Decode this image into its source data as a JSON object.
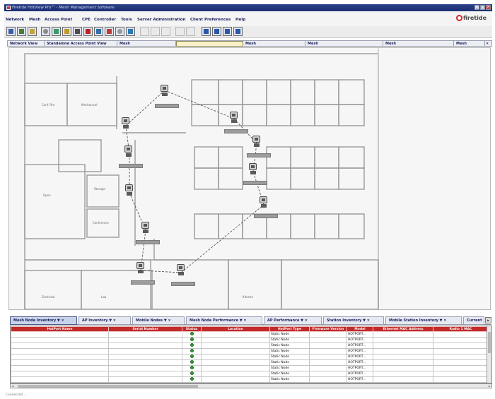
{
  "window": {
    "title": "Firetide HotView Pro™ - Mesh Management Software"
  },
  "menu": [
    {
      "label": "Network"
    },
    {
      "label": "Mesh"
    },
    {
      "label": "Access Point"
    },
    {
      "label": "CPE"
    },
    {
      "label": "Controller"
    },
    {
      "label": "Tools"
    },
    {
      "label": "Server Administration"
    },
    {
      "label": "Client Preferences"
    },
    {
      "label": "Help"
    }
  ],
  "brand": {
    "logo_text": "firetide"
  },
  "toolbar": {
    "icons": [
      "grid-icon",
      "tree-icon",
      "layout-icon",
      "wrench-icon",
      "map-icon",
      "node-icon",
      "ap-icon",
      "alarm-icon",
      "report-icon",
      "stop-icon",
      "gear-icon",
      "save-icon",
      "table-icon",
      "table-icon",
      "table-icon",
      "list-icon",
      "list-icon",
      "zoom-in-icon",
      "zoom-out-icon",
      "zoom-fit-icon",
      "zoom-actual-icon"
    ]
  },
  "view_tabs": [
    {
      "label": "Network View"
    },
    {
      "label": "Standalone Access Point View"
    },
    {
      "label": "Mesh"
    },
    {
      "label": ""
    },
    {
      "label": "Mesh"
    },
    {
      "label": "Mesh"
    },
    {
      "label": "Mesh"
    },
    {
      "label": "Mesh"
    }
  ],
  "map": {
    "rooms": [
      "Conf. Rm",
      "Mechanical",
      "Storage",
      "Conference",
      "Open",
      "Electrical",
      "Lab",
      "Kitchen"
    ],
    "ap_count": 12
  },
  "bottom_tabs": [
    {
      "label": "Mesh Node Inventory"
    },
    {
      "label": "AP Inventory"
    },
    {
      "label": "Mobile Nodes"
    },
    {
      "label": "Mesh Node Performance"
    },
    {
      "label": "AP Performance"
    },
    {
      "label": "Station Inventory"
    },
    {
      "label": "Mobile Station Inventory"
    },
    {
      "label": "Current"
    }
  ],
  "grid": {
    "columns": [
      "HotPort Name",
      "Serial Number",
      "Status",
      "Location",
      "HotPort Type",
      "Firmware Version",
      "Model",
      "Ethernet MAC Address",
      "Radio 1 MAC"
    ],
    "rows": [
      {
        "type": "Static Node",
        "model": "HOTPORT..."
      },
      {
        "type": "Static Node",
        "model": "HOTPORT..."
      },
      {
        "type": "Static Node",
        "model": "HOTPORT..."
      },
      {
        "type": "Static Node",
        "model": "HOTPORT..."
      },
      {
        "type": "Static Node",
        "model": "HOTPORT..."
      },
      {
        "type": "Static Node",
        "model": "HOTPORT..."
      },
      {
        "type": "Static Node",
        "model": "HOTPORT..."
      },
      {
        "type": "Static Node",
        "model": "HOTPORT..."
      },
      {
        "type": "Static Node",
        "model": "HOTPORT..."
      }
    ]
  },
  "status": {
    "text": "Connected ..."
  }
}
